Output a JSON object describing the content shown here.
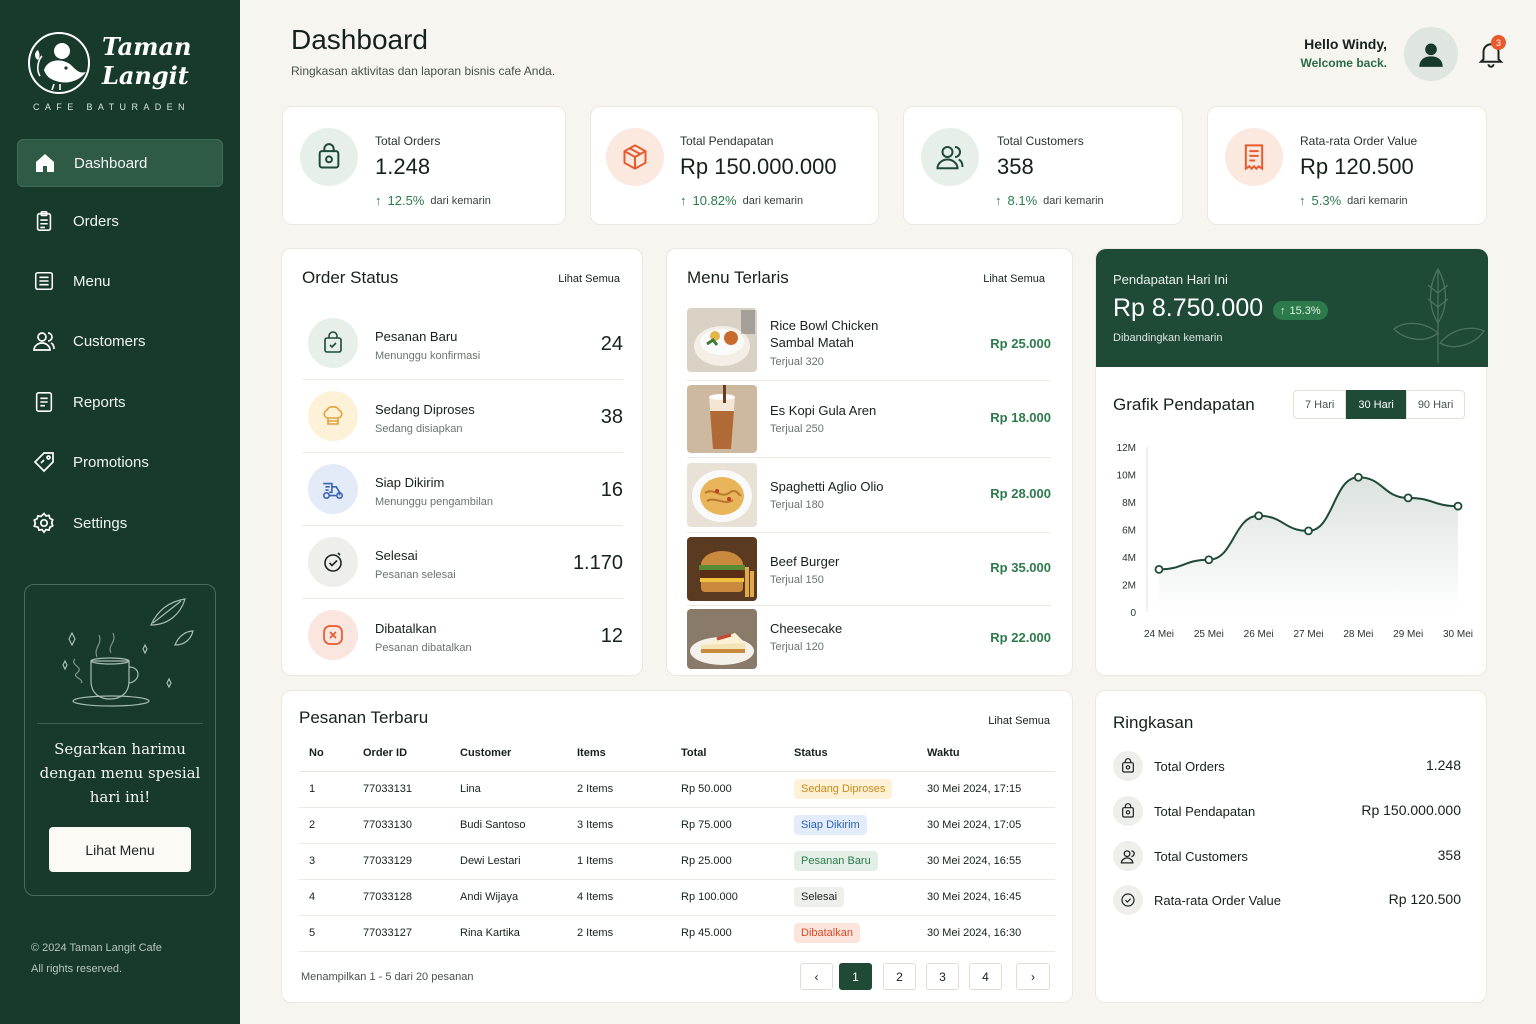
{
  "brand": {
    "name_line1": "Taman",
    "name_line2": "Langit",
    "tagline": "CAFE BATURADEN"
  },
  "sidebar": {
    "items": [
      {
        "label": "Dashboard",
        "icon": "home-icon",
        "active": true
      },
      {
        "label": "Orders",
        "icon": "clipboard-icon"
      },
      {
        "label": "Menu",
        "icon": "menu-list-icon"
      },
      {
        "label": "Customers",
        "icon": "users-icon"
      },
      {
        "label": "Reports",
        "icon": "report-icon"
      },
      {
        "label": "Promotions",
        "icon": "tag-icon"
      },
      {
        "label": "Settings",
        "icon": "gear-icon"
      }
    ],
    "promo": {
      "line1": "Segarkan harimu",
      "line2": "dengan menu spesial",
      "line3": "hari ini!",
      "button": "Lihat Menu"
    },
    "copyright": "© 2024 Taman Langit Cafe",
    "rights": "All rights reserved."
  },
  "header": {
    "title": "Dashboard",
    "subtitle": "Ringkasan aktivitas dan laporan bisnis cafe Anda.",
    "greeting": "Hello Windy,",
    "welcome": "Welcome back.",
    "notification_count": "3"
  },
  "stats": [
    {
      "label": "Total Orders",
      "value": "1.248",
      "change": "12.5%",
      "note": "dari kemarin",
      "icon": "shopping-bag-icon"
    },
    {
      "label": "Total Pendapatan",
      "value": "Rp 150.000.000",
      "change": "10.82%",
      "note": "dari kemarin",
      "icon": "box-icon"
    },
    {
      "label": "Total Customers",
      "value": "358",
      "change": "8.1%",
      "note": "dari kemarin",
      "icon": "users-icon"
    },
    {
      "label": "Rata-rata Order Value",
      "value": "Rp 120.500",
      "change": "5.3%",
      "note": "dari kemarin",
      "icon": "receipt-icon"
    }
  ],
  "order_status": {
    "title": "Order Status",
    "see_all": "Lihat Semua",
    "items": [
      {
        "name": "Pesanan Baru",
        "sub": "Menunggu konfirmasi",
        "count": "24"
      },
      {
        "name": "Sedang Diproses",
        "sub": "Sedang disiapkan",
        "count": "38"
      },
      {
        "name": "Siap Dikirim",
        "sub": "Menunggu pengambilan",
        "count": "16"
      },
      {
        "name": "Selesai",
        "sub": "Pesanan selesai",
        "count": "1.170"
      },
      {
        "name": "Dibatalkan",
        "sub": "Pesanan dibatalkan",
        "count": "12"
      }
    ]
  },
  "menu_terlaris": {
    "title": "Menu Terlaris",
    "see_all": "Lihat Semua",
    "items": [
      {
        "name": "Rice Bowl Chicken Sambal Matah",
        "sold": "Terjual 320",
        "price": "Rp 25.000"
      },
      {
        "name": "Es Kopi Gula Aren",
        "sold": "Terjual 250",
        "price": "Rp 18.000"
      },
      {
        "name": "Spaghetti Aglio Olio",
        "sold": "Terjual 180",
        "price": "Rp 28.000"
      },
      {
        "name": "Beef Burger",
        "sold": "Terjual 150",
        "price": "Rp 35.000"
      },
      {
        "name": "Cheesecake",
        "sold": "Terjual 120",
        "price": "Rp 22.000"
      }
    ]
  },
  "revenue": {
    "label": "Pendapatan Hari Ini",
    "value": "Rp 8.750.000",
    "change": "15.3%",
    "compare": "Dibandingkan kemarin"
  },
  "chart_data": {
    "type": "area",
    "title": "Grafik Pendapatan",
    "tabs": [
      "7 Hari",
      "30 Hari",
      "90 Hari"
    ],
    "active_tab": "30 Hari",
    "categories": [
      "24 Mei",
      "25 Mei",
      "26 Mei",
      "27 Mei",
      "28 Mei",
      "29 Mei",
      "30 Mei"
    ],
    "values": [
      3100000,
      3800000,
      7000000,
      5900000,
      9800000,
      8300000,
      7700000
    ],
    "yticks": [
      "0",
      "2M",
      "4M",
      "6M",
      "8M",
      "10M",
      "12M"
    ],
    "ylim": [
      0,
      12000000
    ],
    "line_color": "#1f4a36"
  },
  "recent_orders": {
    "title": "Pesanan Terbaru",
    "see_all": "Lihat Semua",
    "columns": [
      "No",
      "Order ID",
      "Customer",
      "Items",
      "Total",
      "Status",
      "Waktu"
    ],
    "rows": [
      {
        "no": "1",
        "id": "77033131",
        "customer": "Lina",
        "items": "2 Items",
        "total": "Rp 50.000",
        "status": "Sedang Diproses",
        "time": "30 Mei 2024, 17:15"
      },
      {
        "no": "2",
        "id": "77033130",
        "customer": "Budi Santoso",
        "items": "3 Items",
        "total": "Rp 75.000",
        "status": "Siap Dikirim",
        "time": "30 Mei 2024, 17:05"
      },
      {
        "no": "3",
        "id": "77033129",
        "customer": "Dewi Lestari",
        "items": "1 Items",
        "total": "Rp 25.000",
        "status": "Pesanan Baru",
        "time": "30 Mei 2024, 16:55"
      },
      {
        "no": "4",
        "id": "77033128",
        "customer": "Andi Wijaya",
        "items": "4 Items",
        "total": "Rp 100.000",
        "status": "Selesai",
        "time": "30 Mei 2024, 16:45"
      },
      {
        "no": "5",
        "id": "77033127",
        "customer": "Rina Kartika",
        "items": "2 Items",
        "total": "Rp 45.000",
        "status": "Dibatalkan",
        "time": "30 Mei 2024, 16:30"
      }
    ],
    "footer": "Menampilkan 1 - 5 dari 20 pesanan",
    "pages": [
      "1",
      "2",
      "3",
      "4"
    ],
    "current_page": "1"
  },
  "summary": {
    "title": "Ringkasan",
    "items": [
      {
        "label": "Total Orders",
        "value": "1.248"
      },
      {
        "label": "Total Pendapatan",
        "value": "Rp 150.000.000"
      },
      {
        "label": "Total Customers",
        "value": "358"
      },
      {
        "label": "Rata-rata Order Value",
        "value": "Rp 120.500"
      }
    ]
  },
  "colors": {
    "sidebar": "#173a2b",
    "accent": "#2d7a4d",
    "orange": "#e8592c",
    "background": "#f7f5ef"
  }
}
